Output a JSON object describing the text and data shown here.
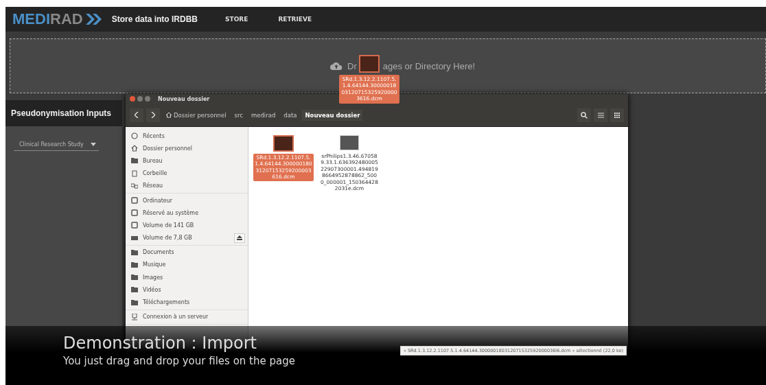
{
  "header": {
    "logo_start": "MEDI",
    "logo_end": "RAD",
    "title": "Store data into IRDBB",
    "nav": [
      {
        "label": "STORE"
      },
      {
        "label": "RETRIEVE"
      }
    ]
  },
  "drop_zone": {
    "text_start": "Dr",
    "text_end": "ages or Directory Here!"
  },
  "dragged_file": {
    "name": "SRd.1.3.12.2.1107.5.1.4.64144.30000018031207153259200003616.dcm"
  },
  "panel": {
    "title": "Pseudonymisation Inputs",
    "select": {
      "value": "Clinical Research Study"
    }
  },
  "file_manager": {
    "title": "Nouveau dossier",
    "breadcrumbs": [
      {
        "label": "Dossier personnel",
        "kind": "home",
        "selected": false
      },
      {
        "label": "src",
        "kind": "plain",
        "selected": false
      },
      {
        "label": "medirad",
        "kind": "plain",
        "selected": false
      },
      {
        "label": "data",
        "kind": "plain",
        "selected": false
      },
      {
        "label": "Nouveau dossier",
        "kind": "plain",
        "selected": true
      }
    ],
    "sidebar": [
      [
        {
          "label": "Récents",
          "kind": "clock"
        },
        {
          "label": "Dossier personnel",
          "kind": "home"
        },
        {
          "label": "Bureau",
          "kind": "folder"
        },
        {
          "label": "Corbeille",
          "kind": "trash"
        },
        {
          "label": "Réseau",
          "kind": "network"
        }
      ],
      [
        {
          "label": "Ordinateur",
          "kind": "computer"
        },
        {
          "label": "Réservé au système",
          "kind": "drive"
        },
        {
          "label": "Volume de 141 GB",
          "kind": "drive"
        },
        {
          "label": "Volume de 7,8 GB",
          "kind": "usb",
          "eject": true
        }
      ],
      [
        {
          "label": "Documents",
          "kind": "folder"
        },
        {
          "label": "Musique",
          "kind": "folder"
        },
        {
          "label": "Images",
          "kind": "folder"
        },
        {
          "label": "Vidéos",
          "kind": "folder"
        },
        {
          "label": "Téléchargements",
          "kind": "folder"
        }
      ],
      [
        {
          "label": "Connexion à un serveur",
          "kind": "server"
        }
      ]
    ],
    "files": [
      {
        "name": "SRd.1.3.12.2.1107.5.1.4.64144.30000018031207153259200003616.dcm",
        "selected": true
      },
      {
        "name": "srPhilips1.3.46.670589.33.1.63639248000522907300001.4948198664952878862_5000_000001_1503644282031e.dcm",
        "selected": false
      }
    ],
    "status": "« SRd.1.3.12.2.1107.5.1.4.64144.300000180312071532592000036l6.dcm » sélectionné (22,0 ko)"
  },
  "caption": {
    "title": "Demonstration : Import",
    "subtitle": "You just drag and drop your files on the page"
  }
}
